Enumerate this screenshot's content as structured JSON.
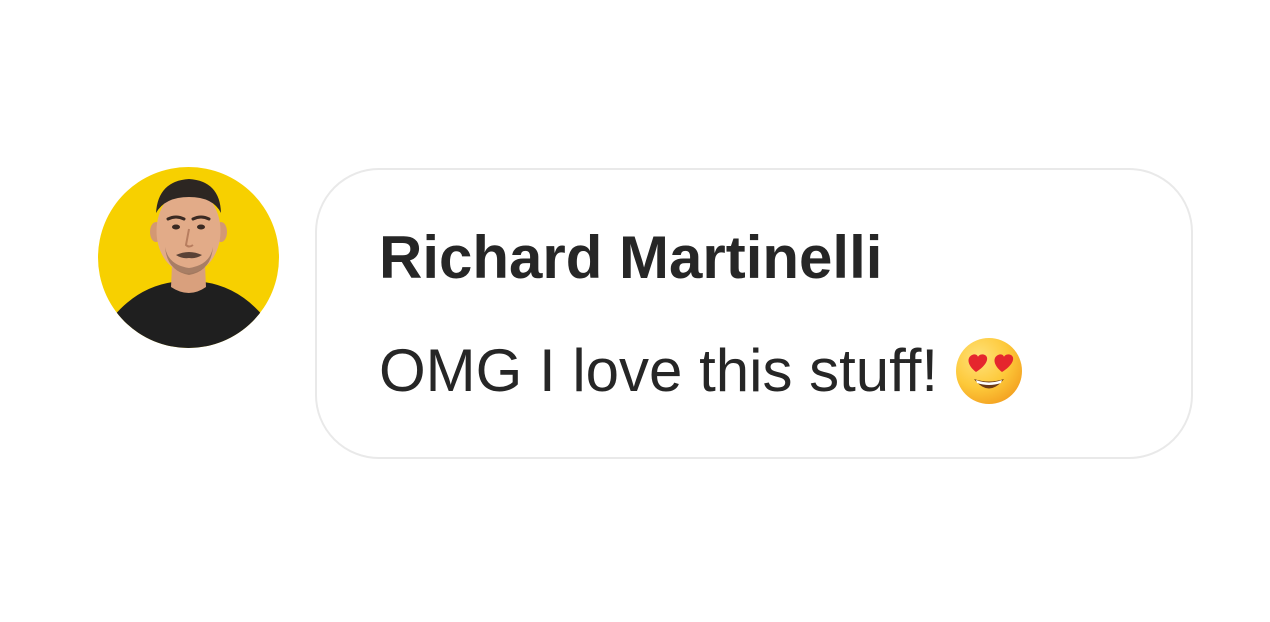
{
  "comment": {
    "author": "Richard Martinelli",
    "text": "OMG I love this stuff!",
    "emoji": "heart-eyes-emoji",
    "avatar_icon": "user-avatar"
  },
  "colors": {
    "avatar_background": "#F7D000",
    "bubble_border": "#e9e9e9",
    "text": "#262626",
    "emoji_face": "#FDC93A",
    "emoji_hearts": "#E5262D"
  }
}
